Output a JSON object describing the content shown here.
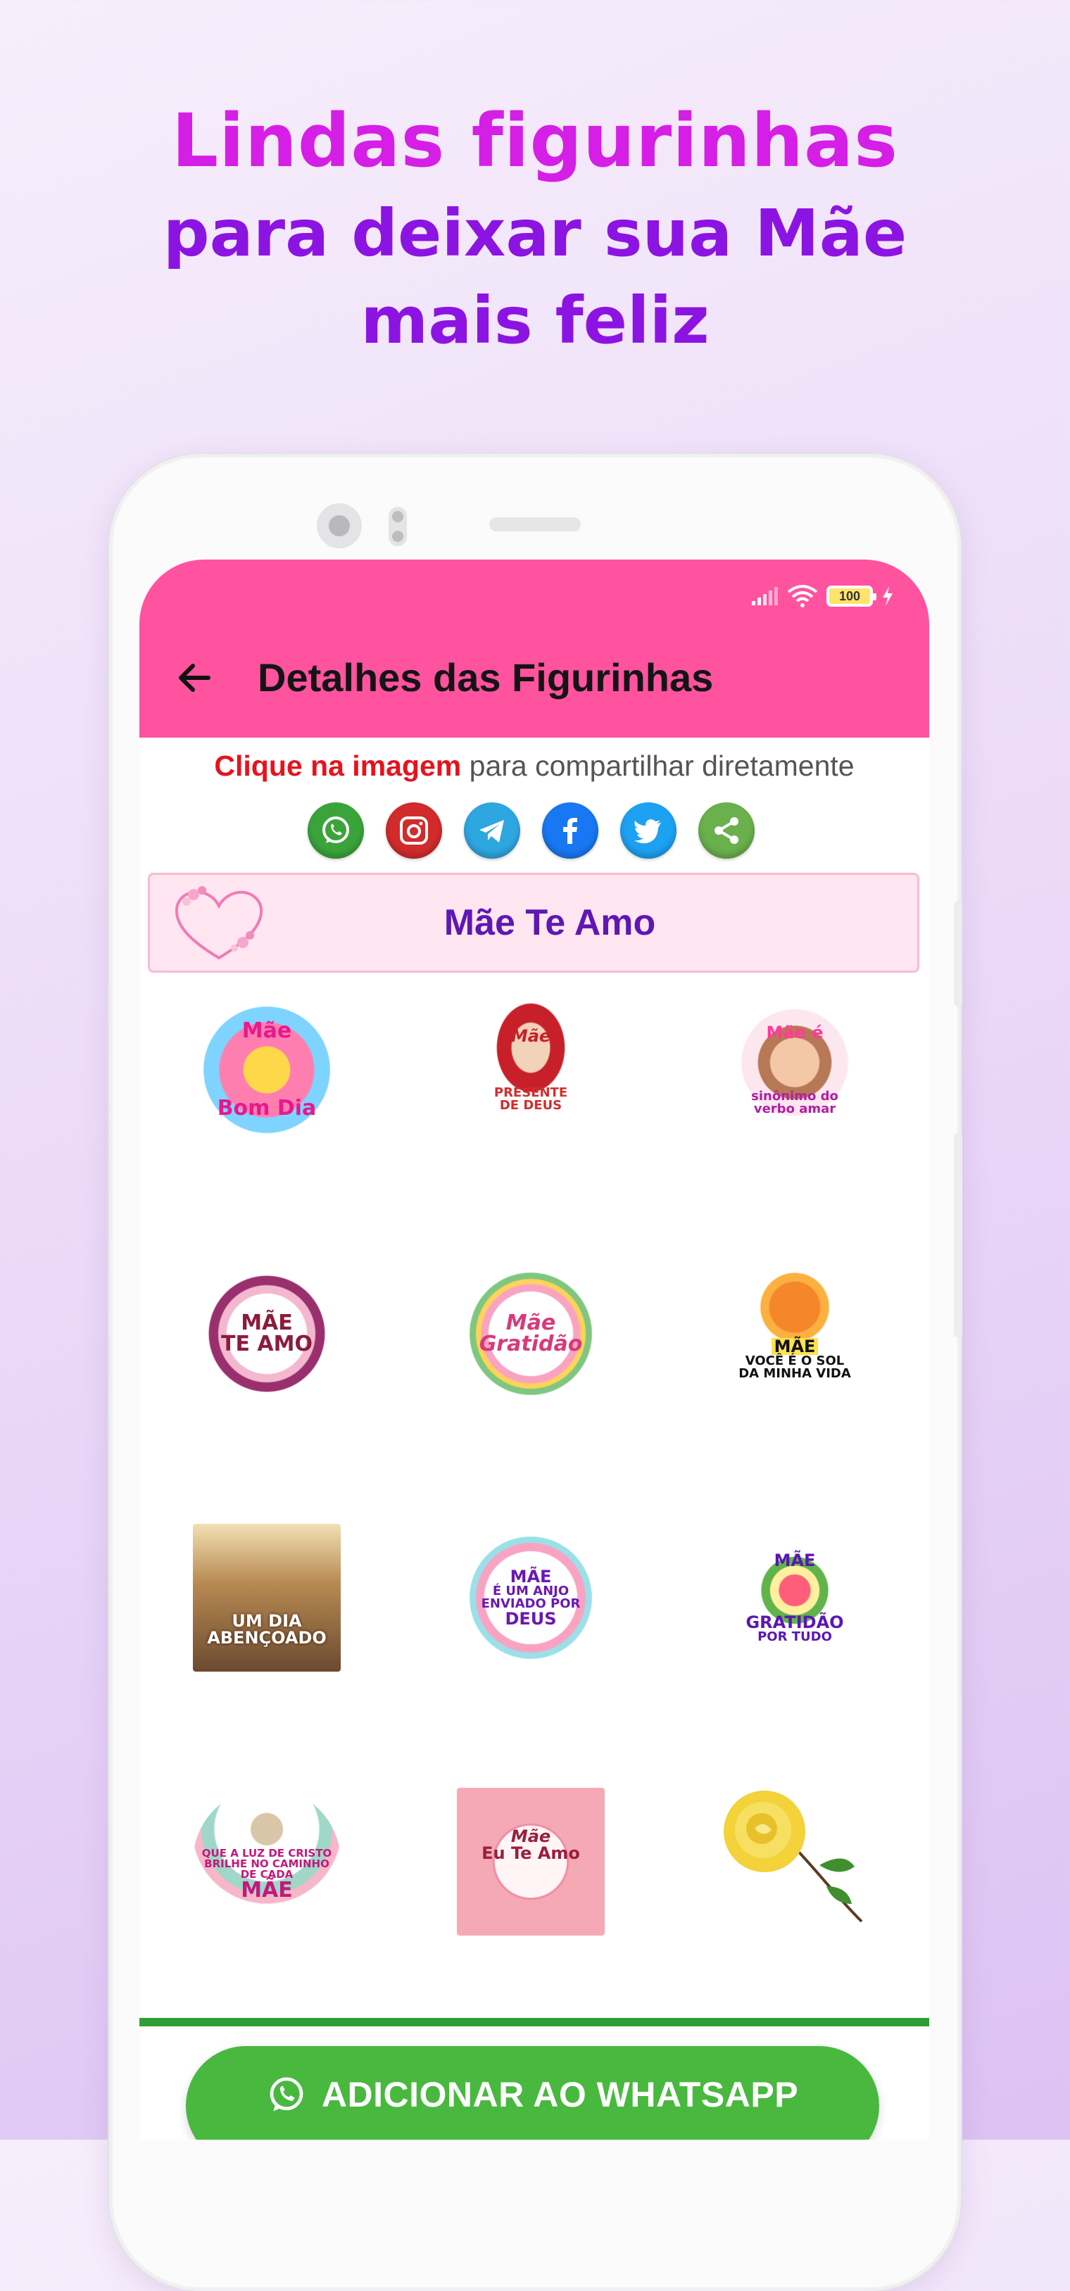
{
  "promo": {
    "line1": "Lindas figurinhas",
    "line2": "para deixar sua Mãe",
    "line3": "mais feliz"
  },
  "status_bar": {
    "battery": "100"
  },
  "app_bar": {
    "title": "Detalhes das Figurinhas",
    "back_icon": "arrow-left-icon"
  },
  "hint": {
    "bold": "Clique na imagem",
    "rest": " para compartilhar diretamente"
  },
  "share_buttons": [
    {
      "name": "whatsapp",
      "icon": "whatsapp-icon",
      "color": "#3aa43a"
    },
    {
      "name": "instagram",
      "icon": "instagram-icon",
      "color": "#d22b2b"
    },
    {
      "name": "telegram",
      "icon": "telegram-icon",
      "color": "#2ea6e0"
    },
    {
      "name": "facebook",
      "icon": "facebook-icon",
      "color": "#1877f2"
    },
    {
      "name": "twitter",
      "icon": "twitter-icon",
      "color": "#1da1f2"
    },
    {
      "name": "share",
      "icon": "share-icon",
      "color": "#6ab04c"
    }
  ],
  "pack": {
    "name": "Mãe Te Amo",
    "icon": "heart-wreath-icon"
  },
  "stickers": [
    {
      "lines": [
        "Mãe",
        "Bom Dia"
      ]
    },
    {
      "lines": [
        "Mãe",
        "PRESENTE",
        "DE DEUS"
      ]
    },
    {
      "lines": [
        "Mãe é",
        "sinônimo do",
        "verbo amar"
      ]
    },
    {
      "lines": [
        "MÃE",
        "TE AMO"
      ]
    },
    {
      "lines": [
        "Mãe",
        "Gratidão"
      ]
    },
    {
      "lines": [
        "MÃE",
        "VOCÊ É O SOL",
        "DA MINHA VIDA"
      ]
    },
    {
      "lines": [
        "UM DIA",
        "ABENÇOADO"
      ]
    },
    {
      "lines": [
        "MÃE",
        "É UM ANJO",
        "ENVIADO POR",
        "DEUS"
      ]
    },
    {
      "lines": [
        "MÃE",
        "GRATIDÃO",
        "POR TUDO"
      ]
    },
    {
      "lines": [
        "QUE A LUZ DE CRISTO",
        "BRILHE NO CAMINHO",
        "DE CADA",
        "MÃE"
      ]
    },
    {
      "lines": [
        "Mãe",
        "Eu Te Amo"
      ]
    },
    {
      "lines": []
    }
  ],
  "add_button": {
    "label": "ADICIONAR AO WHATSAPP",
    "icon": "whatsapp-icon"
  },
  "colors": {
    "accent": "#ff529f",
    "pack_title": "#5f17b4",
    "add_button": "#49b83f",
    "hint_bold": "#e8121c"
  }
}
